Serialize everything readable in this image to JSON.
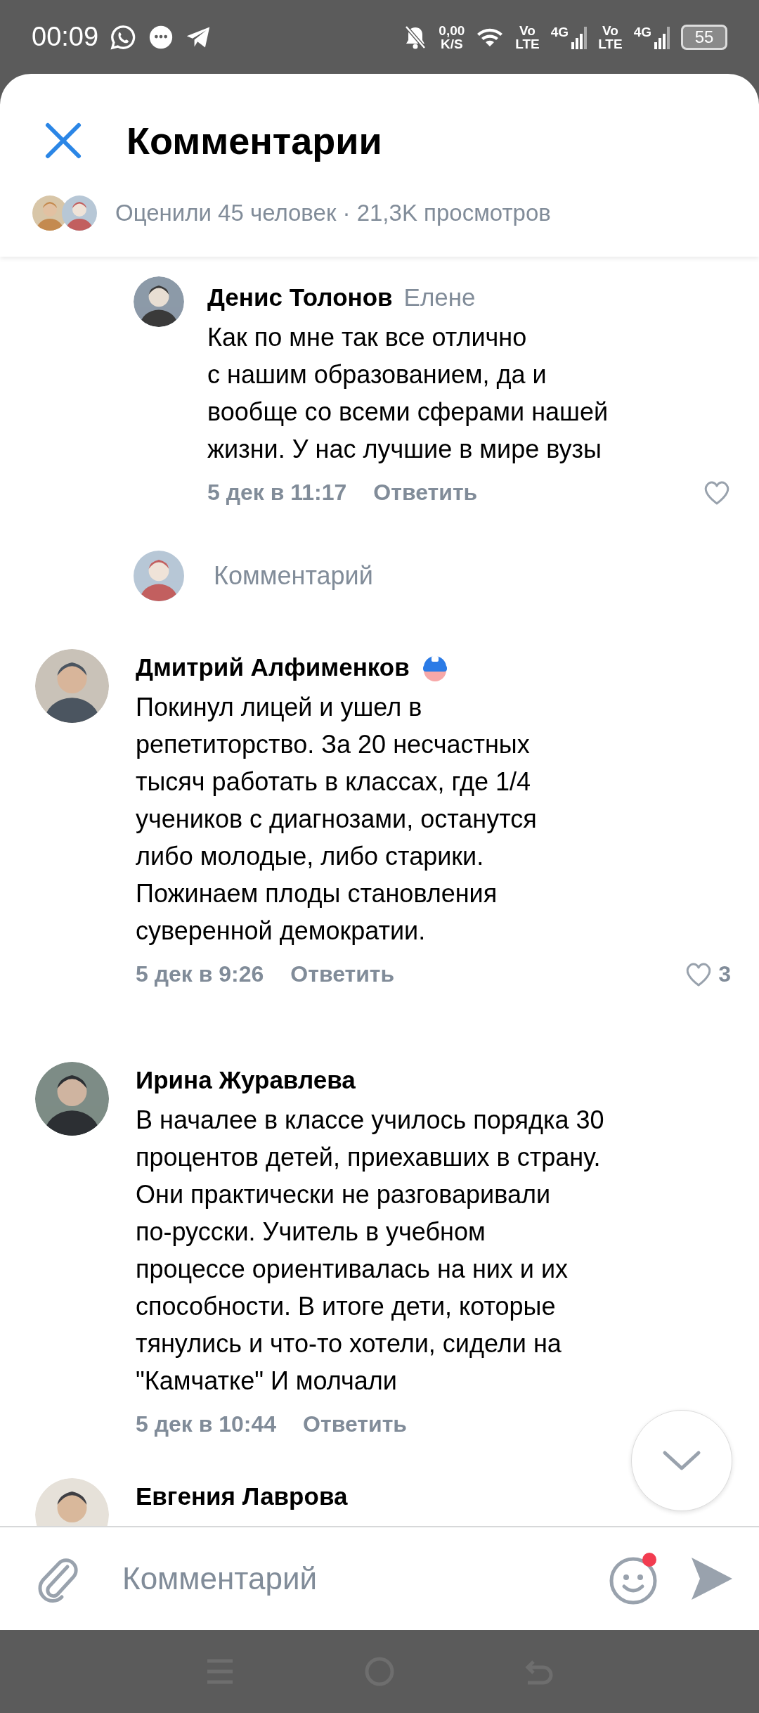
{
  "status_bar": {
    "time": "00:09",
    "net_speed": "0,00",
    "net_unit": "K/S",
    "sims": [
      {
        "vo": "Vo",
        "lte": "LTE",
        "gen": "4G"
      },
      {
        "vo": "Vo",
        "lte": "LTE",
        "gen": "4G"
      }
    ],
    "battery": "55"
  },
  "header": {
    "title": "Комментарии",
    "stats": "Оценили 45 человек · 21,3K просмотров"
  },
  "thread": [
    {
      "kind": "reply",
      "author": "Денис Толонов",
      "reply_to": "Елене",
      "badge": false,
      "text": "Как по мне так все отлично\nс нашим образованием, да и\nвообще со всеми сферами нашей\nжизни. У нас лучшие в мире вузы",
      "date": "5 дек в 11:17",
      "reply_label": "Ответить",
      "liked": false
    },
    {
      "kind": "comment_input",
      "placeholder": "Комментарий"
    },
    {
      "kind": "comment",
      "author": "Дмитрий Алфименков",
      "badge": true,
      "text": "Покинул лицей и ушел в\nрепетиторство. За 20 несчастных\nтысяч работать в классах, где 1/4\nучеников с диагнозами, останутся\nлибо молодые, либо старики.\nПожинаем плоды становления\nсуверенной демократии.",
      "date": "5 дек в 9:26",
      "reply_label": "Ответить",
      "liked": false,
      "likes": "3"
    },
    {
      "kind": "comment",
      "author": "Ирина Журавлева",
      "badge": false,
      "text": "В началее в классе училось порядка 30\nпроцентов детей, приехавших в страну.\nОни практически не разговаривали\nпо-русски. Учитель в учебном\nпроцессе ориентивалась на них и их\nспособности. В итоге дети, которые\nтянулись и что-то хотели, сидели на\n\"Камчатке\" И молчали",
      "date": "5 дек в 10:44",
      "reply_label": "Ответить"
    },
    {
      "kind": "comment",
      "author": "Евгения Лаврова",
      "badge": false
    }
  ],
  "composer": {
    "placeholder": "Комментарий",
    "emoji_notification": true
  }
}
